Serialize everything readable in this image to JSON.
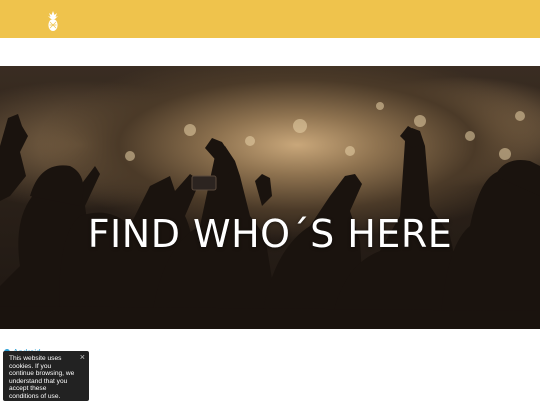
{
  "header": {
    "logo_icon": "pineapple-icon",
    "background_color": "#efc34c"
  },
  "hero": {
    "title": "FIND WHO´S HERE",
    "image": "concert-crowd-photo"
  },
  "android_link": {
    "label": "Android",
    "color": "#2a9fd6"
  },
  "cookie_notice": {
    "text": "This website uses cookies. If you continue browsing, we understand that you accept these conditions of use.",
    "close_label": "×"
  }
}
